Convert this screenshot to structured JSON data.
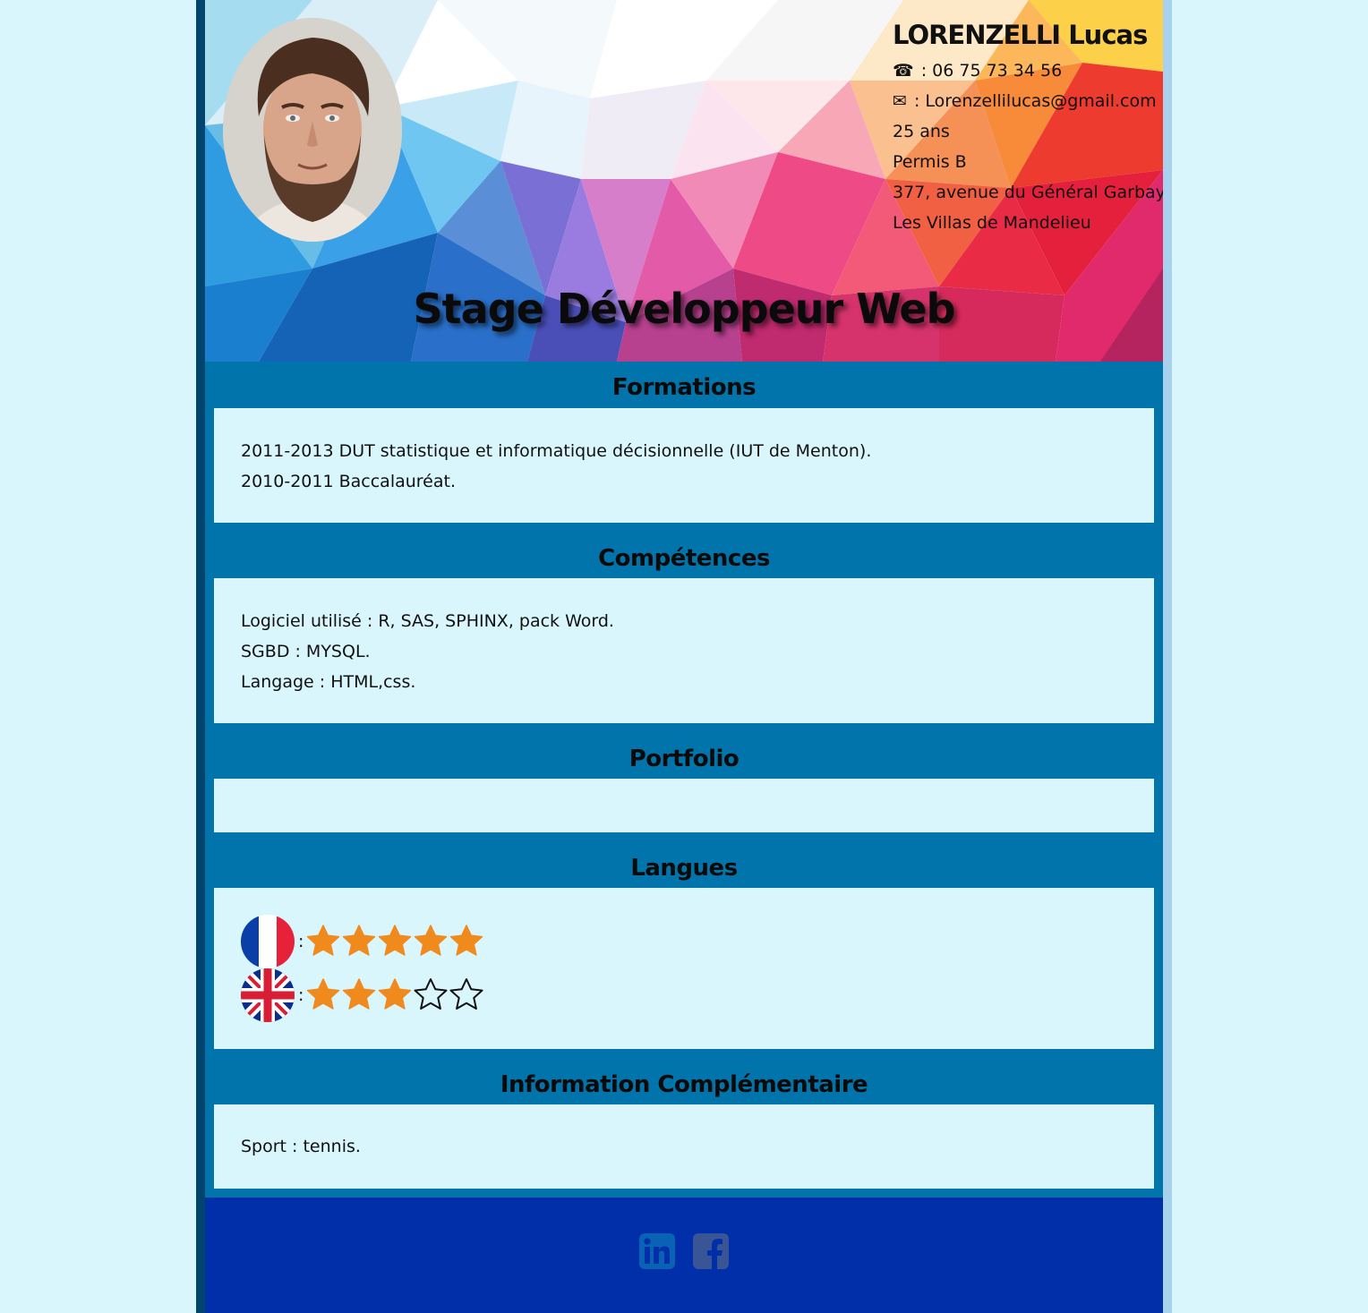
{
  "header": {
    "name": "LORENZELLI Lucas",
    "phone_symbol": "☎",
    "phone": ": 06 75 73 34 56",
    "email_symbol": "✉",
    "email": ": Lorenzellilucas@gmail.com",
    "age": "25 ans",
    "licence": "Permis B",
    "address_line1": "377, avenue du Général Garbay",
    "address_line2": "Les Villas de Mandelieu",
    "job_title": "Stage Développeur Web"
  },
  "sections": {
    "formations": {
      "title": "Formations",
      "items": [
        "2011-2013 DUT statistique et informatique décisionnelle (IUT de Menton).",
        "2010-2011 Baccalauréat."
      ]
    },
    "competences": {
      "title": "Compétences",
      "items": [
        "Logiciel utilisé : R, SAS, SPHINX, pack Word.",
        "SGBD : MYSQL.",
        "Langage : HTML,css."
      ]
    },
    "portfolio": {
      "title": "Portfolio"
    },
    "langues": {
      "title": "Langues",
      "items": [
        {
          "flag_icon": "france-flag-icon",
          "separator": ":",
          "rating": 5,
          "max": 5
        },
        {
          "flag_icon": "uk-flag-icon",
          "separator": ":",
          "rating": 3,
          "max": 5
        }
      ]
    },
    "info": {
      "title": "Information Complémentaire",
      "items": [
        "Sport : tennis."
      ]
    }
  },
  "footer": {
    "social": [
      {
        "icon": "linkedin-icon",
        "color": "#0a62b4"
      },
      {
        "icon": "facebook-icon",
        "color": "#3a5596"
      }
    ]
  },
  "colors": {
    "page_bg": "#d9f6fd",
    "section_bg": "#0175ab",
    "footer_bg": "#002fa9",
    "star_filled": "#f08a1c"
  }
}
